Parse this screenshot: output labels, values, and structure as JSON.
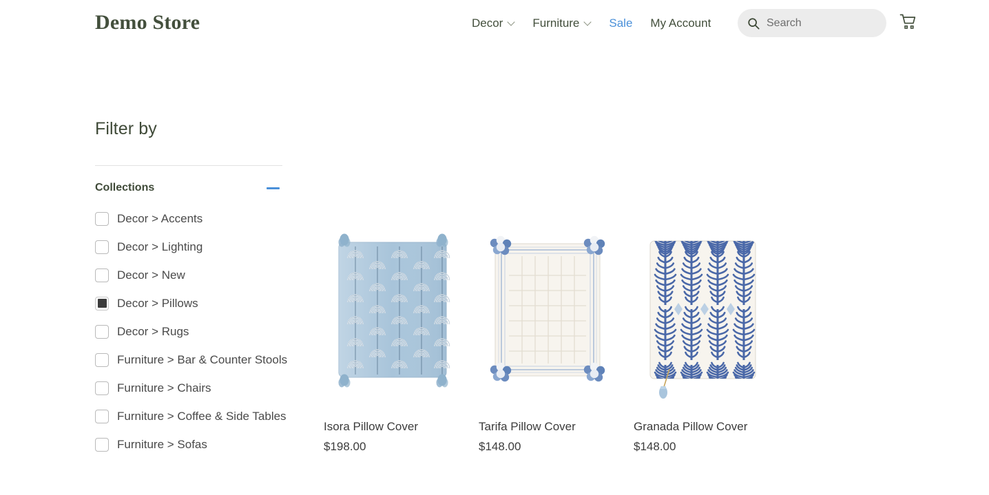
{
  "header": {
    "logo": "Demo Store",
    "nav": [
      {
        "label": "Decor",
        "has_chevron": true,
        "style": "default",
        "icon": "chevron-down-icon"
      },
      {
        "label": "Furniture",
        "has_chevron": true,
        "style": "default",
        "icon": "chevron-down-icon"
      },
      {
        "label": "Sale",
        "has_chevron": false,
        "style": "sale"
      },
      {
        "label": "My Account",
        "has_chevron": false,
        "style": "default"
      }
    ],
    "search": {
      "placeholder": "Search",
      "value": "",
      "icon": "search-icon"
    },
    "cart": {
      "icon": "shopping-cart-icon",
      "label": "Cart"
    }
  },
  "sidebar": {
    "title": "Filter by",
    "group": {
      "label": "Collections",
      "collapse_icon": "minus-icon",
      "expanded": true
    },
    "filters": [
      {
        "label": "Decor > Accents",
        "checked": false
      },
      {
        "label": "Decor > Lighting",
        "checked": false
      },
      {
        "label": "Decor > New",
        "checked": false
      },
      {
        "label": "Decor > Pillows",
        "checked": true
      },
      {
        "label": "Decor > Rugs",
        "checked": false
      },
      {
        "label": "Furniture > Bar & Counter Stools",
        "checked": false
      },
      {
        "label": "Furniture > Chairs",
        "checked": false
      },
      {
        "label": "Furniture > Coffee & Side Tables",
        "checked": false
      },
      {
        "label": "Furniture > Sofas",
        "checked": false
      }
    ]
  },
  "products": [
    {
      "title": "Isora Pillow Cover",
      "price": "$198.00",
      "image": "blue-fan-pattern-pillow"
    },
    {
      "title": "Tarifa Pillow Cover",
      "price": "$148.00",
      "image": "cream-grid-pompom-pillow"
    },
    {
      "title": "Granada Pillow Cover",
      "price": "$148.00",
      "image": "blue-fern-pattern-pillow"
    }
  ],
  "colors": {
    "brand_green": "#434f3c",
    "link_blue": "#4a90d9",
    "text_dark": "#3c3c3c",
    "search_bg": "#ececec",
    "checkbox_fill": "#3b3b3b",
    "pillow_blue": "#a8c4da",
    "pillow_navy": "#4a68a8",
    "pillow_cream": "#f7f4ee"
  }
}
